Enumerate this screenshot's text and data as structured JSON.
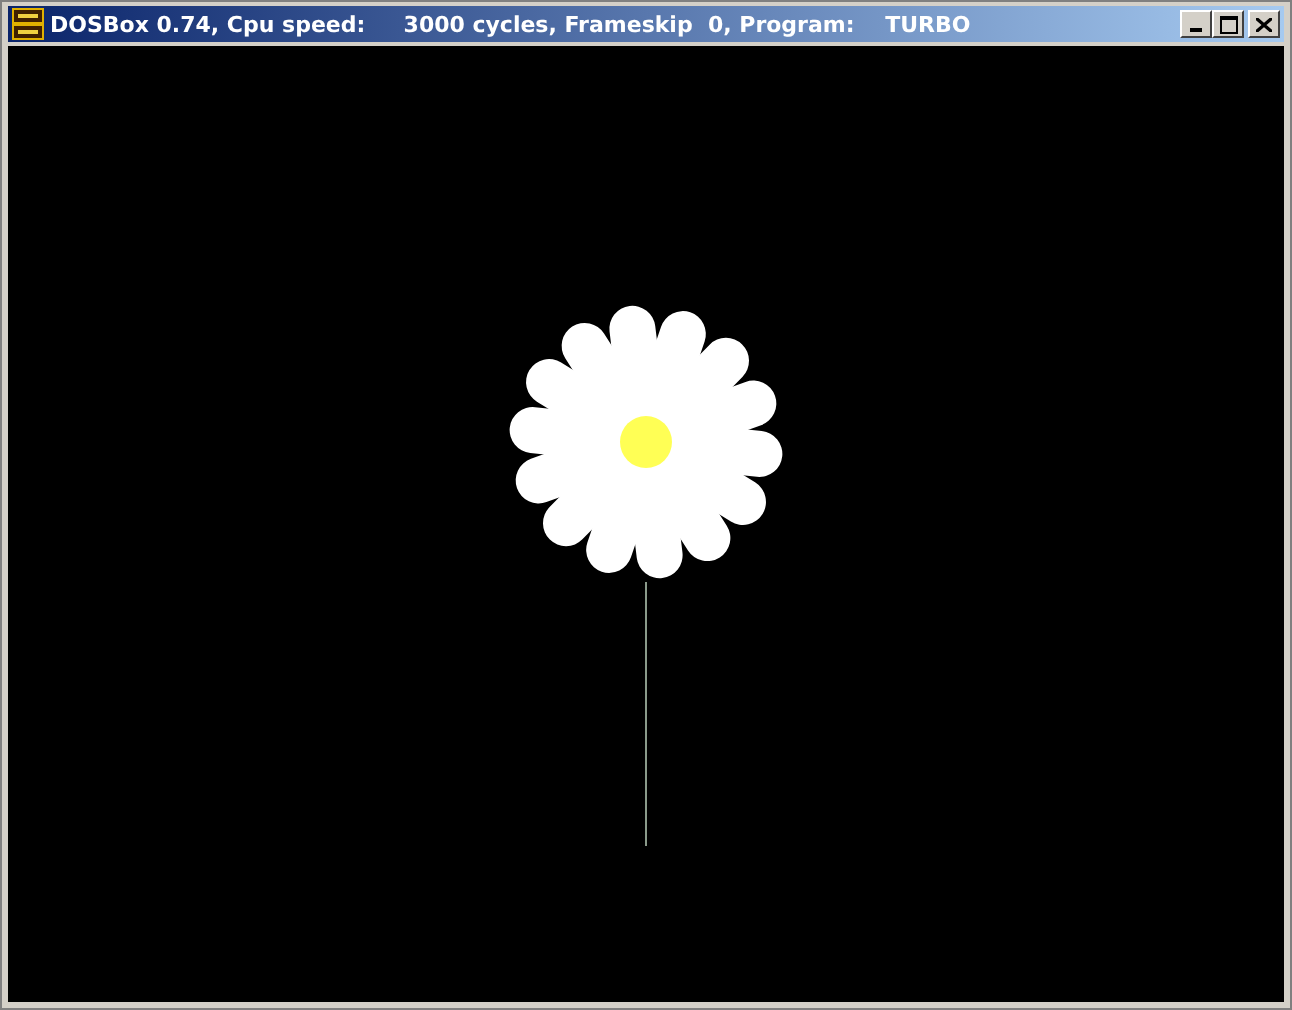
{
  "window": {
    "title": "DOSBox 0.74, Cpu speed:     3000 cycles, Frameskip  0, Program:    TURBO"
  }
}
